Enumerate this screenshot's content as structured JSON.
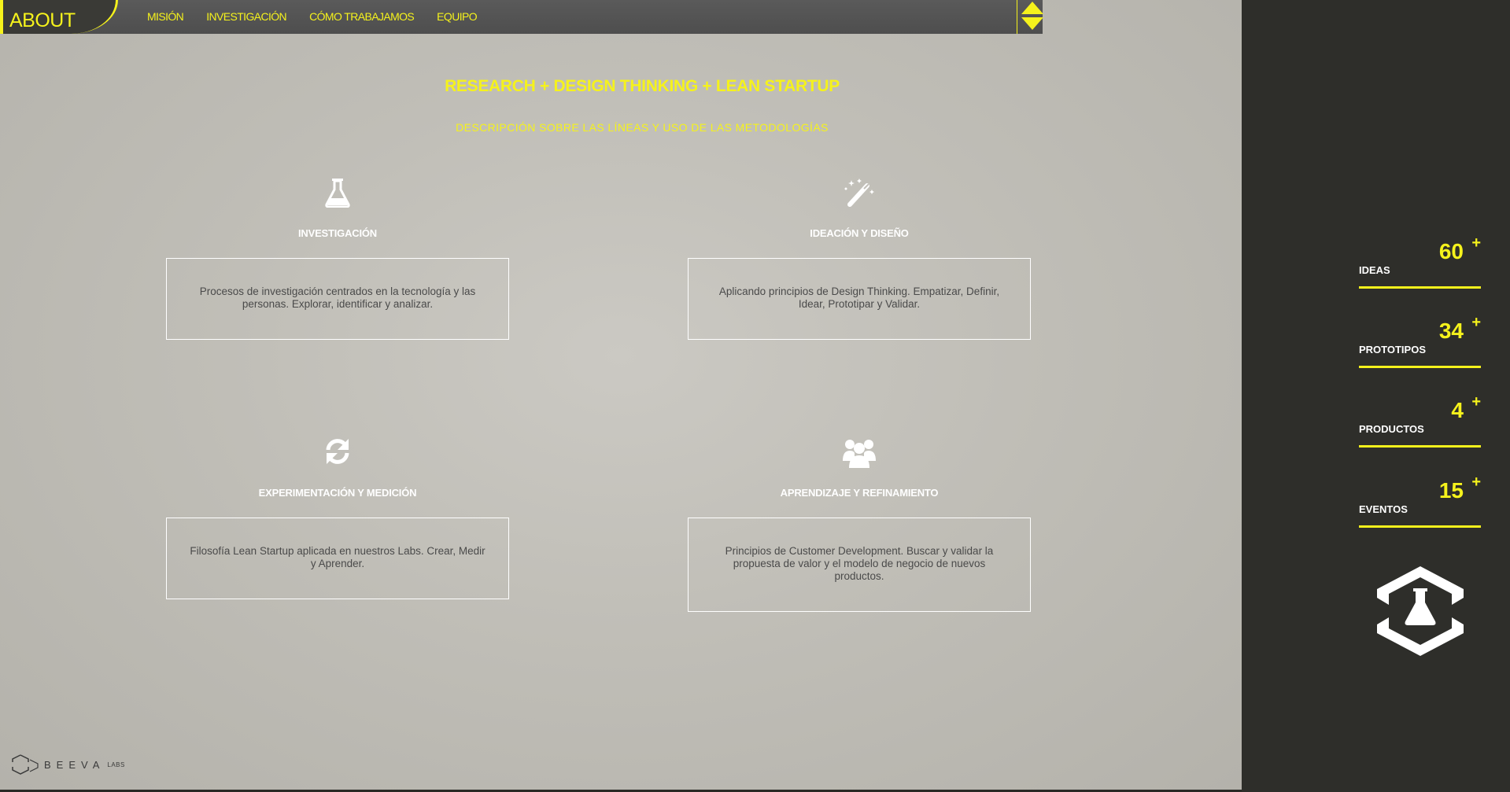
{
  "nav": {
    "section": "ABOUT",
    "items": [
      "MISIÓN",
      "INVESTIGACIÓN",
      "CÓMO TRABAJAMOS",
      "EQUIPO"
    ]
  },
  "hero": {
    "title": "RESEARCH + DESIGN THINKING + LEAN STARTUP",
    "subtitle": "DESCRIPCIÓN SOBRE LAS LÍNEAS Y USO DE LAS METODOLOGÍAS"
  },
  "cards": [
    {
      "icon": "flask-icon",
      "title": "INVESTIGACIÓN",
      "text": "Procesos de investigación centrados en la tecnología y las personas. Explorar, identificar y analizar."
    },
    {
      "icon": "magic-wand-icon",
      "title": "IDEACIÓN Y DISEÑO",
      "text": "Aplicando principios de Design Thinking. Empatizar, Definir, Idear, Prototipar y Validar."
    },
    {
      "icon": "refresh-icon",
      "title": "EXPERIMENTACIÓN Y MEDICIÓN",
      "text": "Filosofía Lean Startup aplicada en nuestros Labs. Crear, Medir y Aprender."
    },
    {
      "icon": "users-icon",
      "title": "APRENDIZAJE Y REFINAMIENTO",
      "text": "Principios de Customer Development. Buscar y validar la propuesta de valor y el modelo de negocio de nuevos productos."
    }
  ],
  "stats": [
    {
      "value": "60",
      "plus": "+",
      "label": "IDEAS"
    },
    {
      "value": "34",
      "plus": "+",
      "label": "PROTOTIPOS"
    },
    {
      "value": "4",
      "plus": "+",
      "label": "PRODUCTOS"
    },
    {
      "value": "15",
      "plus": "+",
      "label": "EVENTOS"
    }
  ],
  "footer": {
    "brand": "BEEVA",
    "sub": "LABS"
  },
  "colors": {
    "accent": "#f5f21c",
    "sidebar": "#2e2e2a",
    "main": "#c3c1ba"
  }
}
